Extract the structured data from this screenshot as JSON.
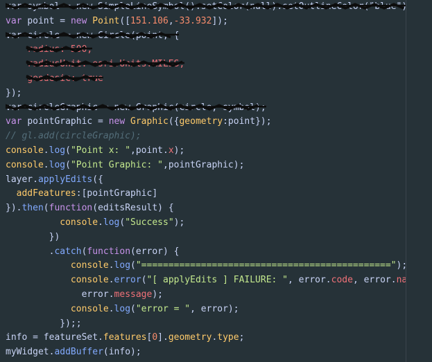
{
  "editor": {
    "lines": [
      [
        {
          "t": "var symbol = new SimpleLineSymbol().setColor(null).setOutlineColor(\"blue\");",
          "c": "plain"
        }
      ],
      [
        {
          "t": "var ",
          "c": "kw"
        },
        {
          "t": "point = ",
          "c": "plain"
        },
        {
          "t": "new ",
          "c": "kw"
        },
        {
          "t": "Point",
          "c": "cls"
        },
        {
          "t": "([",
          "c": "plain"
        },
        {
          "t": "151.106",
          "c": "num"
        },
        {
          "t": ",",
          "c": "plain"
        },
        {
          "t": "-33.932",
          "c": "num"
        },
        {
          "t": "]);",
          "c": "plain"
        }
      ],
      [
        {
          "t": "var circle = new Circle(point, {",
          "c": "plain"
        }
      ],
      [
        {
          "t": "    radius: 500,",
          "c": "prop"
        }
      ],
      [
        {
          "t": "    radiusUnit: esri.Units.MILES,",
          "c": "prop"
        }
      ],
      [
        {
          "t": "    geodesic: true",
          "c": "prop"
        }
      ],
      [
        {
          "t": "});",
          "c": "plain"
        }
      ],
      [
        {
          "t": "var circleGraphic = new Graphic(circle, symbol);",
          "c": "plain"
        }
      ],
      [
        {
          "t": "var ",
          "c": "kw"
        },
        {
          "t": "pointGraphic = ",
          "c": "plain"
        },
        {
          "t": "new ",
          "c": "kw"
        },
        {
          "t": "Graphic",
          "c": "cls"
        },
        {
          "t": "({",
          "c": "plain"
        },
        {
          "t": "geometry",
          "c": "cls"
        },
        {
          "t": ":point});",
          "c": "plain"
        }
      ],
      [
        {
          "t": "// gl.add(circleGraphic);",
          "c": "comment"
        }
      ],
      [
        {
          "t": "console",
          "c": "cls"
        },
        {
          "t": ".",
          "c": "plain"
        },
        {
          "t": "log",
          "c": "fn"
        },
        {
          "t": "(",
          "c": "plain"
        },
        {
          "t": "\"Point x: \"",
          "c": "str"
        },
        {
          "t": ",point.",
          "c": "plain"
        },
        {
          "t": "x",
          "c": "prop"
        },
        {
          "t": ");",
          "c": "plain"
        }
      ],
      [
        {
          "t": "console",
          "c": "cls"
        },
        {
          "t": ".",
          "c": "plain"
        },
        {
          "t": "log",
          "c": "fn"
        },
        {
          "t": "(",
          "c": "plain"
        },
        {
          "t": "\"Point Graphic: \"",
          "c": "str"
        },
        {
          "t": ",pointGraphic);",
          "c": "plain"
        }
      ],
      [
        {
          "t": "layer.",
          "c": "plain"
        },
        {
          "t": "applyEdits",
          "c": "fn"
        },
        {
          "t": "({",
          "c": "plain"
        }
      ],
      [
        {
          "t": "  addFeatures",
          "c": "cls"
        },
        {
          "t": ":[pointGraphic]",
          "c": "plain"
        }
      ],
      [
        {
          "t": "}).",
          "c": "plain"
        },
        {
          "t": "then",
          "c": "fn"
        },
        {
          "t": "(",
          "c": "plain"
        },
        {
          "t": "function",
          "c": "kw"
        },
        {
          "t": "(editsResult) {",
          "c": "plain"
        }
      ],
      [
        {
          "t": "          console",
          "c": "cls"
        },
        {
          "t": ".",
          "c": "plain"
        },
        {
          "t": "log",
          "c": "fn"
        },
        {
          "t": "(",
          "c": "plain"
        },
        {
          "t": "\"Success\"",
          "c": "str"
        },
        {
          "t": ");",
          "c": "plain"
        }
      ],
      [
        {
          "t": "        })",
          "c": "plain"
        }
      ],
      [
        {
          "t": "        .",
          "c": "plain"
        },
        {
          "t": "catch",
          "c": "fn"
        },
        {
          "t": "(",
          "c": "plain"
        },
        {
          "t": "function",
          "c": "kw"
        },
        {
          "t": "(error) {",
          "c": "plain"
        }
      ],
      [
        {
          "t": "            console",
          "c": "cls"
        },
        {
          "t": ".",
          "c": "plain"
        },
        {
          "t": "log",
          "c": "fn"
        },
        {
          "t": "(",
          "c": "plain"
        },
        {
          "t": "\"==============================================\"",
          "c": "str"
        },
        {
          "t": ");",
          "c": "plain"
        }
      ],
      [
        {
          "t": "            console",
          "c": "cls"
        },
        {
          "t": ".",
          "c": "plain"
        },
        {
          "t": "error",
          "c": "fn"
        },
        {
          "t": "(",
          "c": "plain"
        },
        {
          "t": "\"[ applyEdits ] FAILURE: \"",
          "c": "str"
        },
        {
          "t": ", error.",
          "c": "plain"
        },
        {
          "t": "code",
          "c": "prop"
        },
        {
          "t": ", error.",
          "c": "plain"
        },
        {
          "t": "name",
          "c": "prop"
        },
        {
          "t": ",",
          "c": "plain"
        }
      ],
      [
        {
          "t": "              error.",
          "c": "plain"
        },
        {
          "t": "message",
          "c": "prop"
        },
        {
          "t": ");",
          "c": "plain"
        }
      ],
      [
        {
          "t": "            console",
          "c": "cls"
        },
        {
          "t": ".",
          "c": "plain"
        },
        {
          "t": "log",
          "c": "fn"
        },
        {
          "t": "(",
          "c": "plain"
        },
        {
          "t": "\"error = \"",
          "c": "str"
        },
        {
          "t": ", error);",
          "c": "plain"
        }
      ],
      [
        {
          "t": "          });;",
          "c": "plain"
        }
      ],
      [
        {
          "t": "info = featureSet.",
          "c": "plain"
        },
        {
          "t": "features",
          "c": "cls"
        },
        {
          "t": "[",
          "c": "plain"
        },
        {
          "t": "0",
          "c": "num"
        },
        {
          "t": "].",
          "c": "plain"
        },
        {
          "t": "geometry",
          "c": "cls"
        },
        {
          "t": ".",
          "c": "plain"
        },
        {
          "t": "type",
          "c": "cls"
        },
        {
          "t": ";",
          "c": "plain"
        }
      ],
      [
        {
          "t": "myWidget.",
          "c": "plain"
        },
        {
          "t": "addBuffer",
          "c": "fn"
        },
        {
          "t": "(info);",
          "c": "plain"
        }
      ]
    ],
    "redacted_lines": [
      0,
      2,
      3,
      4,
      5,
      7
    ],
    "colors": {
      "background": "#263238",
      "scribble": "#0d0d0d"
    }
  }
}
